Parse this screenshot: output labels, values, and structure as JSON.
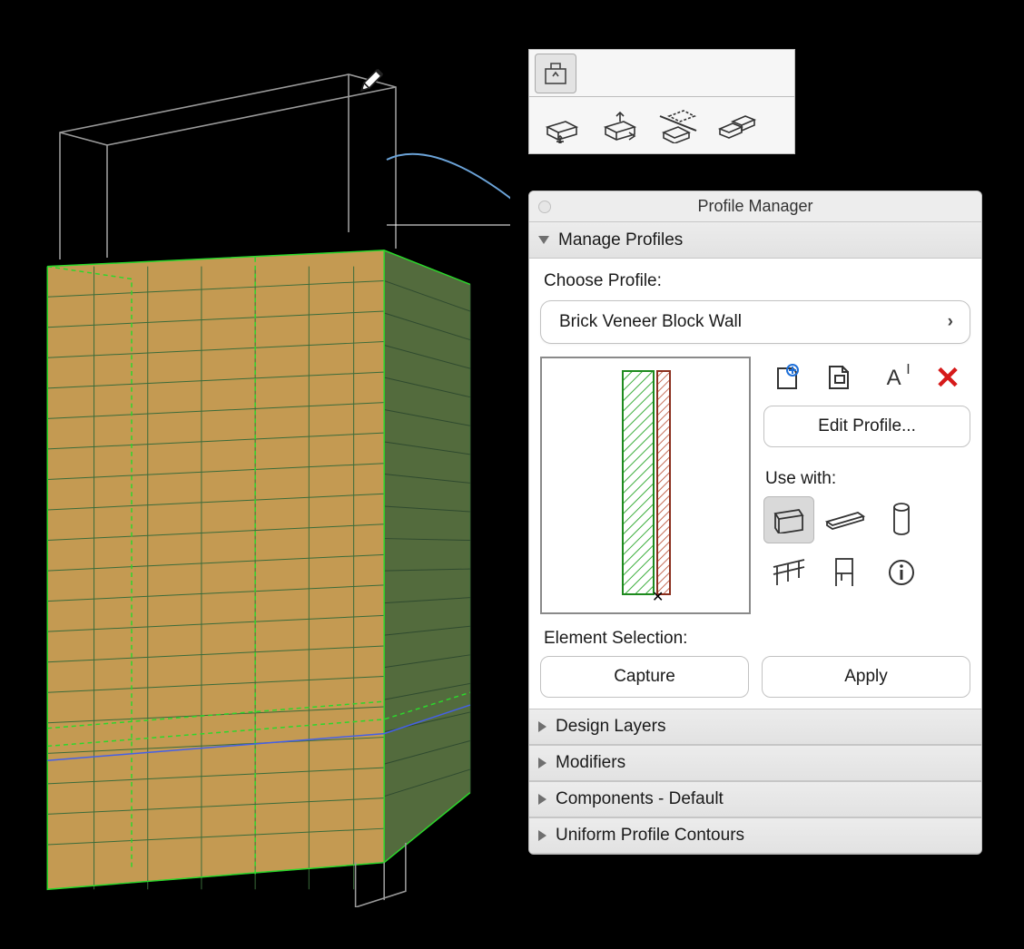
{
  "panel": {
    "title": "Profile Manager",
    "manage_header": "Manage Profiles",
    "choose_label": "Choose Profile:",
    "dropdown_value": "Brick Veneer Block Wall",
    "edit_button": "Edit Profile...",
    "use_with_label": "Use with:",
    "element_selection_label": "Element Selection:",
    "capture": "Capture",
    "apply": "Apply",
    "sections": {
      "design_layers": "Design Layers",
      "modifiers": "Modifiers",
      "components": "Components - Default",
      "contours": "Uniform Profile Contours"
    }
  },
  "icons": {
    "new_profile": "new-profile-icon",
    "duplicate_profile": "duplicate-profile-icon",
    "rename_profile": "rename-profile-icon",
    "delete_profile": "delete-profile-icon"
  },
  "toolbox_icons": {
    "parent": "goto-parent-icon",
    "move": "move-box-icon",
    "shift": "shift-box-icon",
    "cut": "cut-box-icon",
    "multi": "multi-box-icon"
  },
  "use_with": {
    "wall": "wall-icon",
    "beam": "beam-icon",
    "column": "column-icon",
    "railing": "railing-icon",
    "object": "object-icon",
    "info": "info-icon"
  },
  "viewport": {
    "tool_cursor": "pencil-icon"
  },
  "colors": {
    "accent_green": "#2bd82b",
    "delete_red": "#d61a1a"
  }
}
